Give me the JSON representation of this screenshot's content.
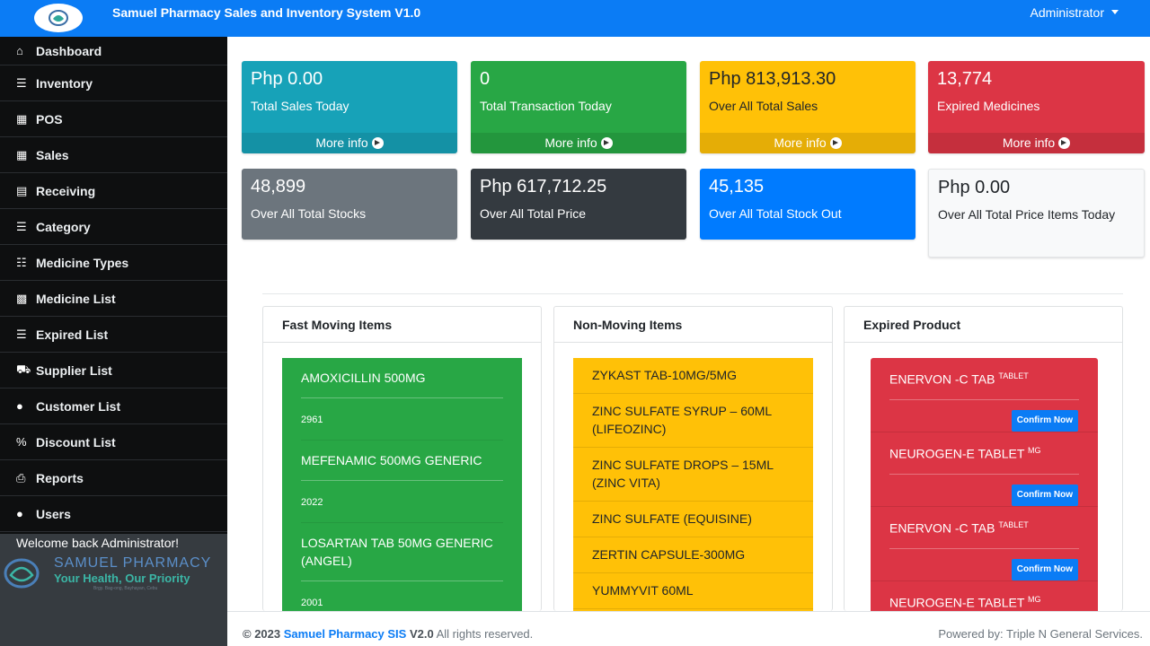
{
  "header": {
    "brand": "Samuel Pharmacy Sales and Inventory System V1.0",
    "user_menu": "Administrator"
  },
  "sidebar": {
    "items": [
      {
        "label": "Dashboard",
        "icon": "home-icon"
      },
      {
        "label": "Inventory",
        "icon": "list-icon"
      },
      {
        "label": "POS",
        "icon": "coins-icon"
      },
      {
        "label": "Sales",
        "icon": "coins-icon"
      },
      {
        "label": "Receiving",
        "icon": "file-icon"
      },
      {
        "label": "Category",
        "icon": "list-icon"
      },
      {
        "label": "Medicine Types",
        "icon": "table-list-icon"
      },
      {
        "label": "Medicine List",
        "icon": "boxes-icon"
      },
      {
        "label": "Expired List",
        "icon": "list-icon"
      },
      {
        "label": "Supplier List",
        "icon": "truck-icon"
      },
      {
        "label": "Customer List",
        "icon": "user-friends-icon"
      },
      {
        "label": "Discount List",
        "icon": "percent-icon"
      },
      {
        "label": "Reports",
        "icon": "print-icon"
      },
      {
        "label": "Users",
        "icon": "users-icon"
      }
    ],
    "welcome": "Welcome back Administrator!",
    "watermark": {
      "title": "SAMUEL PHARMACY",
      "slogan": "Your Health, Our Priority",
      "address": "Brgy. Bag-ong, Bayhayan, Cebu"
    }
  },
  "stats": [
    {
      "value": "Php 0.00",
      "label": "Total Sales Today",
      "more": "More info",
      "color": "#17a2b8"
    },
    {
      "value": "0",
      "label": "Total Transaction Today",
      "more": "More info",
      "color": "#28a745"
    },
    {
      "value": "Php 813,913.30",
      "label": "Over All Total Sales",
      "more": "More info",
      "color": "#ffc107"
    },
    {
      "value": "13,774",
      "label": "Expired Medicines",
      "more": "More info",
      "color": "#dc3545"
    },
    {
      "value": "48,899",
      "label": "Over All Total Stocks",
      "color": "#6c757d"
    },
    {
      "value": "Php 617,712.25",
      "label": "Over All Total Price",
      "color": "#343a40"
    },
    {
      "value": "45,135",
      "label": "Over All Total Stock Out",
      "color": "#007bff"
    },
    {
      "value": "Php 0.00",
      "label": "Over All Total Price Items Today",
      "color": "#f8f9fa"
    }
  ],
  "fast_moving": {
    "title": "Fast Moving Items",
    "items": [
      {
        "name": "AMOXICILLIN 500MG",
        "qty": "2961"
      },
      {
        "name": "MEFENAMIC 500MG GENERIC",
        "qty": "2022"
      },
      {
        "name": "LOSARTAN TAB 50MG GENERIC (ANGEL)",
        "qty": "2001"
      }
    ]
  },
  "non_moving": {
    "title": "Non-Moving Items",
    "items": [
      "ZYKAST TAB-10MG/5MG",
      "ZINC SULFATE SYRUP – 60ML (LIFEOZINC)",
      "ZINC SULFATE DROPS – 15ML (ZINC VITA)",
      "ZINC SULFATE (EQUISINE)",
      "ZERTIN CAPSULE-300MG",
      "YUMMYVIT 60ML"
    ]
  },
  "expired": {
    "title": "Expired Product",
    "confirm_label": "Confirm Now",
    "items": [
      {
        "name": "ENERVON -C TAB",
        "unit": "TABLET"
      },
      {
        "name": "NEUROGEN-E TABLET",
        "unit": "MG"
      },
      {
        "name": "ENERVON -C TAB",
        "unit": "TABLET"
      },
      {
        "name": "NEUROGEN-E TABLET",
        "unit": "MG"
      }
    ]
  },
  "footer": {
    "copyright": "© 2023",
    "app_name": "Samuel Pharmacy SIS",
    "version": "V2.0",
    "rights": "All rights reserved.",
    "powered": "Powered by: Triple N General Services."
  }
}
